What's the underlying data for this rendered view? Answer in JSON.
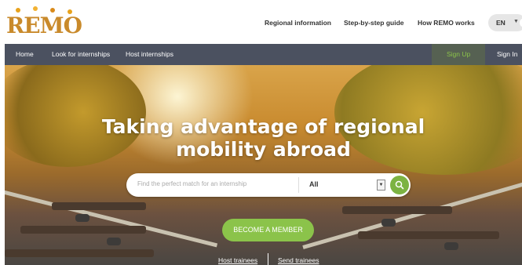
{
  "brand": {
    "logo_text": "REMO",
    "dot_colors": [
      "#e8a21c",
      "#f2b233",
      "#d98a1a",
      "#e8a21c"
    ]
  },
  "header": {
    "links": [
      "Regional information",
      "Step-by-step guide",
      "How REMO works"
    ],
    "language": "EN"
  },
  "nav": {
    "left": [
      "Home",
      "Look for internships",
      "Host internships"
    ],
    "sign_up": "Sign Up",
    "sign_in": "Sign In"
  },
  "hero": {
    "title_line1": "Taking advantage of regional",
    "title_line2": "mobility abroad",
    "search_placeholder": "Find the perfect match for an internship",
    "search_value": "",
    "category_selected": "All",
    "cta_label": "BECOME A MEMBER",
    "sublinks": [
      "Host trainees",
      "Send trainees"
    ]
  },
  "colors": {
    "accent_green": "#8bc34a",
    "nav_bg": "#4b5160",
    "logo": "#c98a2b"
  },
  "icons": {
    "search": "search-icon",
    "dropdown": "chevron-down-icon",
    "flag": "uk-flag-icon"
  }
}
